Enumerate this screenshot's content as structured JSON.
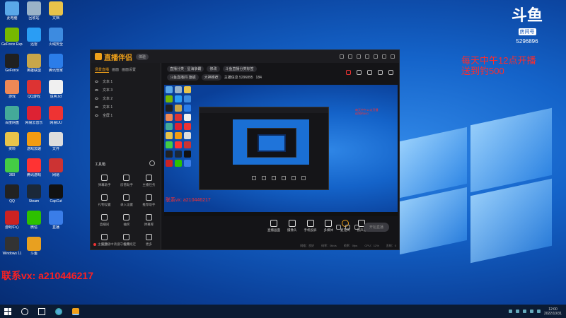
{
  "desktop": {
    "watermark": {
      "logo": "斗鱼",
      "sub": "房间号",
      "room": "5296896"
    },
    "promo_lines": [
      "每天中午12点开播",
      "送到钓500"
    ],
    "contact": "联系vx: a210446217",
    "icons": [
      {
        "label": "此电脑",
        "color": "#5aa7e8"
      },
      {
        "label": "回收站",
        "color": "#9ab3c8"
      },
      {
        "label": "文档",
        "color": "#e8c34a"
      },
      {
        "label": "GeForce Experience",
        "color": "#76b900"
      },
      {
        "label": "迅雷",
        "color": "#2a9df4"
      },
      {
        "label": "火绒安全",
        "color": "#3d8be0"
      },
      {
        "label": "GeForce",
        "color": "#202020"
      },
      {
        "label": "英雄联盟",
        "color": "#c8a64a"
      },
      {
        "label": "腾讯管家",
        "color": "#2b7de9"
      },
      {
        "label": "游戏",
        "color": "#e85"
      },
      {
        "label": "QQ游戏",
        "color": "#d33"
      },
      {
        "label": "说明.txt",
        "color": "#f0f0f0"
      },
      {
        "label": "百度网盘",
        "color": "#4a9"
      },
      {
        "label": "网易云音乐",
        "color": "#d23"
      },
      {
        "label": "网易UU",
        "color": "#e33"
      },
      {
        "label": "资料",
        "color": "#e8c34a"
      },
      {
        "label": "游戏加速",
        "color": "#f39c12"
      },
      {
        "label": "文件",
        "color": "#ddd"
      },
      {
        "label": "360",
        "color": "#4c4"
      },
      {
        "label": "腾讯游戏",
        "color": "#f33"
      },
      {
        "label": "网易",
        "color": "#c33"
      },
      {
        "label": "QQ",
        "color": "#222"
      },
      {
        "label": "Steam",
        "color": "#1b2838"
      },
      {
        "label": "CapCut",
        "color": "#111"
      },
      {
        "label": "游戏中心",
        "color": "#c22"
      },
      {
        "label": "微信",
        "color": "#2dc100"
      },
      {
        "label": "直播",
        "color": "#3a7de8"
      },
      {
        "label": "Windows 11",
        "color": "#333"
      },
      {
        "label": "斗鱼",
        "color": "#e8a020"
      }
    ]
  },
  "app": {
    "name": "直播伴侣",
    "badge": "体验",
    "tabs": [
      "场景直播",
      "画面",
      "画面设置"
    ],
    "scenes": [
      "文本 1",
      "文本 3",
      "文本 2",
      "文本 1",
      "全屏 1"
    ],
    "toolbox_title": "工具箱",
    "tools": [
      "弹幕助手",
      "房管助手",
      "主播任务",
      "礼物设置",
      "录入设置",
      "推荐助手",
      "直播间",
      "抽奖",
      "弹幕库",
      "竞猜",
      "投票",
      "更多"
    ],
    "notice": "主播直播中请遵守相关规定",
    "room": {
      "category": "直播分类",
      "category_value": "星海争霸",
      "edit": "修改",
      "title_chip": "斗鱼直播间·旗舰",
      "tag": "大神推荐",
      "notice_chip": "斗鱼直播分类标签",
      "room_label": "主播信息 5296895",
      "fans": "184"
    },
    "controls": [
      "直播画面",
      "摄像头",
      "手机投屏",
      "多媒体",
      "麦克风",
      "扬声器"
    ],
    "start_button": "开始直播",
    "status": [
      "网络：良好",
      "码率：0kb/s",
      "帧率：0fps",
      "CPU：12%",
      "丢帧：0"
    ]
  },
  "taskbar": {
    "time": "12:00",
    "date": "2022/10/31"
  }
}
